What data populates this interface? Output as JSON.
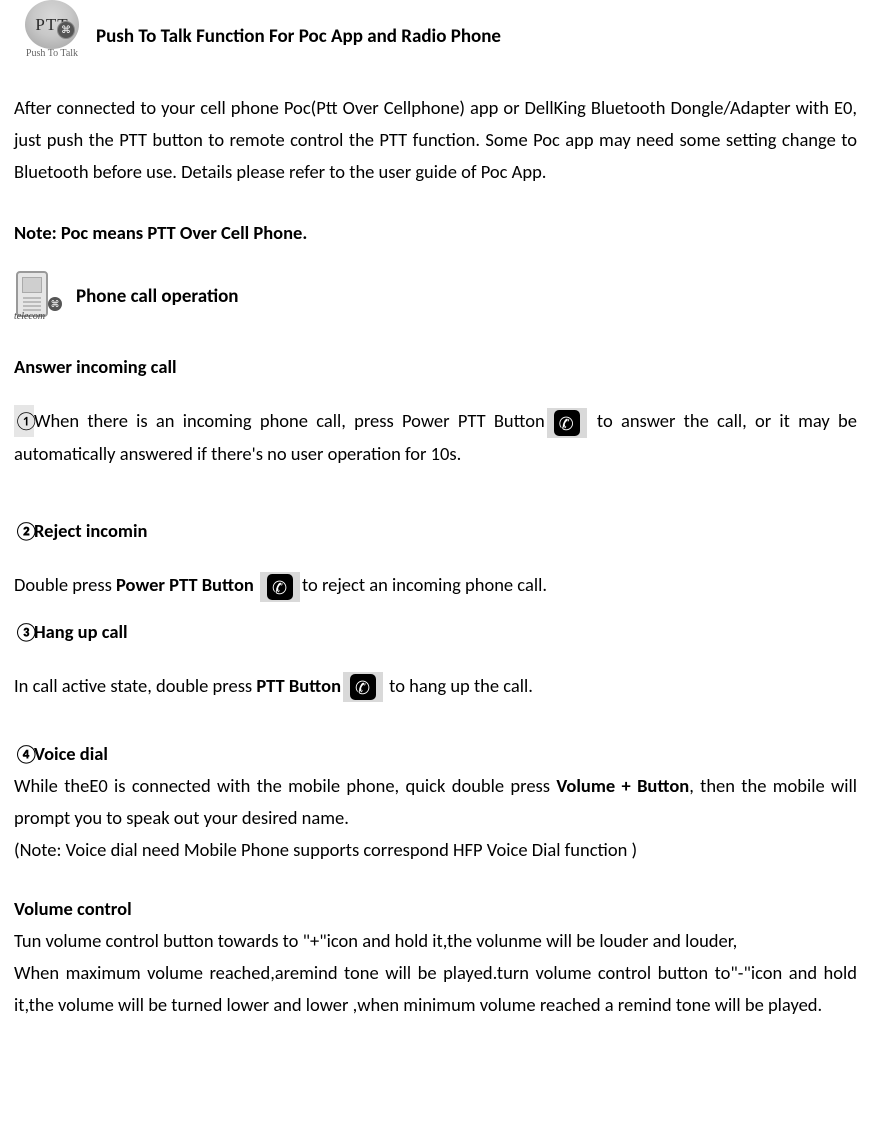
{
  "logo": {
    "acronym": "PTT",
    "sublabel": "Push To Talk"
  },
  "title": "Push To Talk Function For Poc App and Radio Phone",
  "intro": "After connected to your cell phone Poc(Ptt Over Cellphone) app or  DellKing Bluetooth Dongle/Adapter with E0, just push the PTT button to remote control the PTT function. Some Poc app may need some setting change to Bluetooth before use. Details please refer to the user guide of Poc App.",
  "note": "Note: Poc means PTT Over Cell Phone.",
  "phone_section": {
    "icon_label": "telecom",
    "heading": "Phone call operation"
  },
  "answer": {
    "heading": "Answer incoming call",
    "marker": "①",
    "pre": "When there is an incoming phone call, press Power PTT Button",
    "post": " to answer the call, or it may be automatically answered if there's no user operation  for 10s."
  },
  "reject": {
    "marker": "②",
    "heading_rest": "Reject incomin",
    "pre": "Double press ",
    "bold": "Power PTT Button ",
    "post": "to reject an incoming phone call."
  },
  "hangup": {
    "marker": "③",
    "heading_rest": "Hang up call",
    "pre": "In call active state, double press ",
    "bold": "PTT Button",
    "post": " to hang up the call."
  },
  "voicedial": {
    "marker": "④",
    "heading_rest": "Voice dial",
    "line1_pre": "While theE0 is connected with the mobile phone, quick double press ",
    "line1_bold": "Volume + Button",
    "line1_post": ", then the mobile will prompt you to speak out your desired name.",
    "line2": "(Note: Voice dial need Mobile Phone supports correspond HFP Voice Dial function )"
  },
  "volume": {
    "heading": "Volume control",
    "line1": "Tun volume control button towards to \"+\"icon and hold it,the volunme will be louder and louder,",
    "line2": "When maximum volume reached,aremind tone will be played.turn volume control  button to\"-\"icon and hold it,the volume will be turned lower and lower ,when minimum volume reached a remind tone will be played."
  }
}
